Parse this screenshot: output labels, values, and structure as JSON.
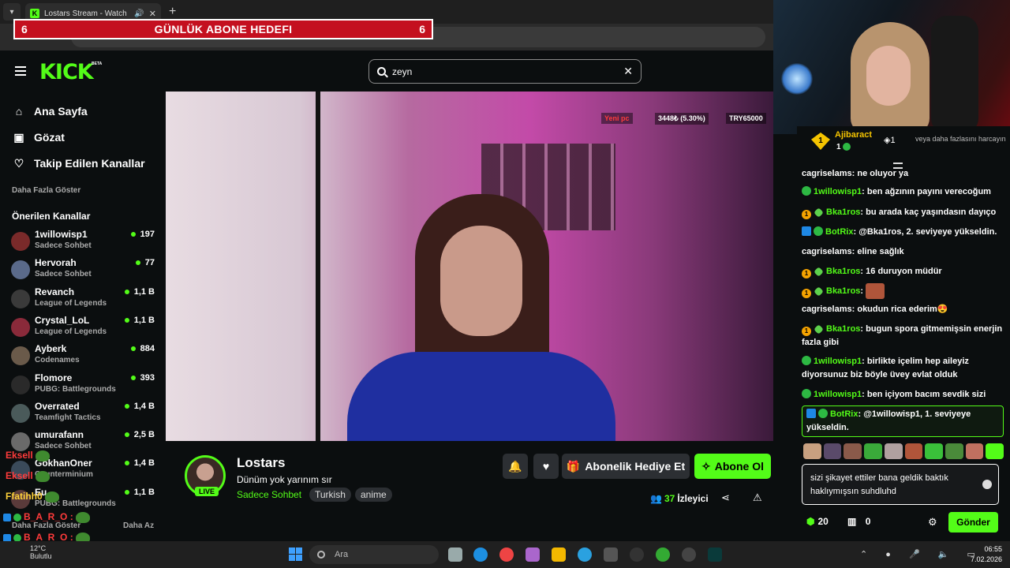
{
  "browser": {
    "tab_title": "Lostars Stream - Watch Live",
    "tab_favicon": "K",
    "new_tab": "+"
  },
  "goal_banner": {
    "left_count": "6",
    "title": "GÜNLÜK ABONE HEDEFI",
    "right_count": "6"
  },
  "header": {
    "logo": "KICK",
    "beta": "BETA",
    "search_value": "zeyn",
    "clear": "✕"
  },
  "sidebar": {
    "nav": [
      {
        "label": "Ana Sayfa",
        "icon": "home-icon",
        "glyph": "⌂"
      },
      {
        "label": "Gözat",
        "icon": "browse-icon",
        "glyph": "▣"
      },
      {
        "label": "Takip Edilen Kanallar",
        "icon": "heart-icon",
        "glyph": "♡"
      }
    ],
    "show_more": "Daha Fazla Göster",
    "recommended_title": "Önerilen Kanallar",
    "channels": [
      {
        "name": "1willowisp1",
        "category": "Sadece Sohbet",
        "viewers": "197",
        "avatar_color": "#7a2a2a"
      },
      {
        "name": "Hervorah",
        "category": "Sadece Sohbet",
        "viewers": "77",
        "avatar_color": "#5a6a8a"
      },
      {
        "name": "Revanch",
        "category": "League of Legends",
        "viewers": "1,1 B",
        "avatar_color": "#3a3a3a"
      },
      {
        "name": "Crystal_LoL",
        "category": "League of Legends",
        "viewers": "1,1 B",
        "avatar_color": "#8a2a3a"
      },
      {
        "name": "Ayberk",
        "category": "Codenames",
        "viewers": "884",
        "avatar_color": "#6a5a4a"
      },
      {
        "name": "Flomore",
        "category": "PUBG: Battlegrounds",
        "viewers": "393",
        "avatar_color": "#2a2a2a"
      },
      {
        "name": "Overrated",
        "category": "Teamfight Tactics",
        "viewers": "1,4 B",
        "avatar_color": "#4a5a5a"
      },
      {
        "name": "umurafann",
        "category": "Sadece Sohbet",
        "viewers": "2,5 B",
        "avatar_color": "#6a6a6a"
      },
      {
        "name": "GokhanOner",
        "category": "Counterminium",
        "viewers": "1,4 B",
        "avatar_color": "#3a4a5a"
      },
      {
        "name": "Eu",
        "category": "PUBG: Battlegrounds",
        "viewers": "1,1 B",
        "avatar_color": "#5a3a3a"
      }
    ],
    "show_more_bottom": "Daha Fazla Göster",
    "show_less": "Daha Az"
  },
  "left_overlay": {
    "lines": [
      {
        "user": "Eksell",
        "color": "red"
      },
      {
        "user": "Eksell",
        "color": "red"
      },
      {
        "user": "Ffatihh0",
        "color": "yel"
      },
      {
        "user": "B_A_R_O :",
        "color": "red"
      },
      {
        "user": "B_A_R_O :",
        "color": "red"
      },
      {
        "user": "B_A_R_O :",
        "color": "red"
      }
    ]
  },
  "video_overlay": {
    "ticker_label": "Yeni pc",
    "ticker_progress": "3448₺ (5.30%)",
    "ticker_goal": "TRY65000"
  },
  "stream": {
    "streamer": "Lostars",
    "title": "Dünüm yok yarınım sır",
    "category": "Sadece Sohbet",
    "tags": [
      "Turkish",
      "anime"
    ],
    "live_badge": "LIVE",
    "gift_label": "Abonelik Hediye Et",
    "subscribe_label": "Abone Ol",
    "viewer_count": "37",
    "viewer_label": "İzleyici"
  },
  "chat": {
    "pinned_user": "Ajibaract",
    "pinned_amount": "1",
    "pinned_gem_count": "1",
    "pinned_desc": "veya daha fazlasını harcayın",
    "messages": [
      {
        "badges": [],
        "user": "cagriselams",
        "user_color": "#fff",
        "text": "ne oluyor ya"
      },
      {
        "badges": [
          "ver"
        ],
        "user": "1willowisp1",
        "user_color": "#53fc18",
        "text": "ben ağzının payını verecoğum"
      },
      {
        "badges": [
          "gold",
          "vip"
        ],
        "user": "Bka1ros",
        "user_color": "#53fc18",
        "text": "bu arada kaç yaşındasın dayıço"
      },
      {
        "badges": [
          "bot",
          "ver"
        ],
        "user": "BotRix",
        "user_color": "#53fc18",
        "text": "@Bka1ros, 2. seviyeye yükseldin."
      },
      {
        "badges": [],
        "user": "cagriselams",
        "user_color": "#fff",
        "text": "eline sağlık"
      },
      {
        "badges": [
          "gold",
          "vip"
        ],
        "user": "Bka1ros",
        "user_color": "#53fc18",
        "text": "16 duruyon müdür"
      },
      {
        "badges": [
          "gold",
          "vip"
        ],
        "user": "Bka1ros",
        "user_color": "#53fc18",
        "text": ""
      },
      {
        "badges": [],
        "user": "cagriselams",
        "user_color": "#fff",
        "text": "okudun rica ederim😍"
      },
      {
        "badges": [
          "gold",
          "vip"
        ],
        "user": "Bka1ros",
        "user_color": "#53fc18",
        "text": "bugun spora gitmemişsin enerjin fazla gibi"
      },
      {
        "badges": [
          "ver"
        ],
        "user": "1willowisp1",
        "user_color": "#53fc18",
        "text": "birlikte içelim hep aileyiz diyorsunuz biz böyle üvey evlat olduk"
      },
      {
        "badges": [
          "ver"
        ],
        "user": "1willowisp1",
        "user_color": "#53fc18",
        "text": "ben içiyom bacım sevdik sizi"
      },
      {
        "badges": [
          "bot",
          "ver"
        ],
        "user": "BotRix",
        "user_color": "#53fc18",
        "text": "@1willowisp1, 1. seviyeye yükseldin."
      }
    ],
    "input_value": "sizi şikayet ettiler bana geldik baktık haklıymışsın suhdluhd",
    "points": "20",
    "gifts": "0",
    "send_label": "Gönder"
  },
  "taskbar": {
    "weather": "12°C",
    "weather_sub": "Bulutlu",
    "search_placeholder": "Ara",
    "time": "06:55",
    "date": "7.02.2026"
  },
  "colors": {
    "kick_green": "#53fc18",
    "banner_red": "#c4101f",
    "bg": "#0b0e0f"
  }
}
